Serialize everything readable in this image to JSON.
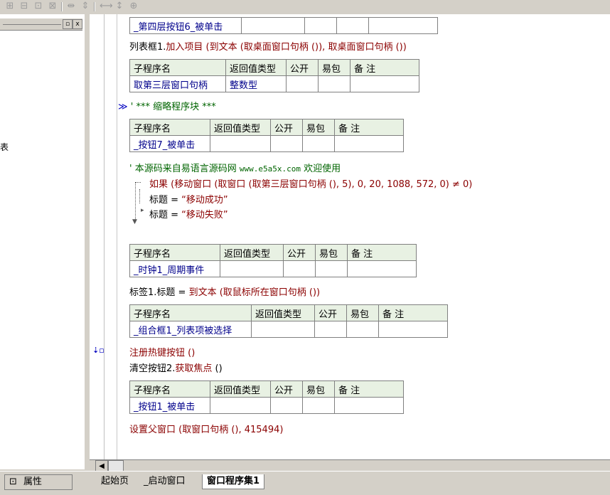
{
  "toolbar": {
    "icons": [
      "align-left-icon",
      "align-center-icon",
      "align-top-icon",
      "align-bottom-icon",
      "space-horizontal-icon",
      "space-vertical-icon",
      "same-width-icon",
      "same-height-icon",
      "same-size-icon"
    ]
  },
  "left_panel": {
    "side_text": "表",
    "btn_min": "▫",
    "btn_close": "x"
  },
  "editor": {
    "t0": {
      "row": [
        "_第四层按钮6_被单击",
        "",
        "",
        "",
        ""
      ]
    },
    "l1": {
      "a": "列表框1.",
      "b": "加入项目",
      "c": " (到文本 (取桌面窗口句柄 ()), 取桌面窗口句柄 ())"
    },
    "t1": {
      "headers": [
        "子程序名",
        "返回值类型",
        "公开",
        "易包",
        "备 注"
      ],
      "row": [
        "取第三层窗口句柄",
        "整数型",
        "",
        "",
        ""
      ]
    },
    "l2": {
      "arrow": "≫",
      "text": "' *** 缩略程序块 ***"
    },
    "t2": {
      "headers": [
        "子程序名",
        "返回值类型",
        "公开",
        "易包",
        "备 注"
      ],
      "row": [
        "_按钮7_被单击",
        "",
        "",
        "",
        ""
      ]
    },
    "l3": {
      "a": "' 本源码来自易语言源码网 ",
      "b": "www.e5a5x.com",
      "c": "  欢迎使用"
    },
    "l4": {
      "a": "如果 (移动窗口 (取窗口 (取第三层窗口句柄 (), 5), 0, 20, 1088, 572, 0) ≠ 0)"
    },
    "l5": {
      "a": "标题 = ",
      "b": "“移动成功”"
    },
    "l6": {
      "a": "标题 = ",
      "b": "“移动失败”"
    },
    "t3": {
      "headers": [
        "子程序名",
        "返回值类型",
        "公开",
        "易包",
        "备 注"
      ],
      "row": [
        "_时钟1_周期事件",
        "",
        "",
        "",
        ""
      ]
    },
    "l7": {
      "a": "标签1.标题 = ",
      "b": "到文本 (取鼠标所在窗口句柄 ())"
    },
    "t4": {
      "headers": [
        "子程序名",
        "返回值类型",
        "公开",
        "易包",
        "备 注"
      ],
      "row": [
        "_组合框1_列表项被选择",
        "",
        "",
        "",
        ""
      ]
    },
    "l8": {
      "a": "注册热键按钮 ()"
    },
    "l9": {
      "a": "清空按钮2.",
      "b": "获取焦点",
      "c": " ()"
    },
    "t5": {
      "headers": [
        "子程序名",
        "返回值类型",
        "公开",
        "易包",
        "备 注"
      ],
      "row": [
        "_按钮1_被单击",
        "",
        "",
        "",
        ""
      ]
    },
    "l10": {
      "a": "设置父窗口 (取窗口句柄 (), 415494)"
    },
    "gutter_icon": "breakpoint-icon"
  },
  "bottom": {
    "prop_label": "属性",
    "tabs": [
      "起始页",
      "_启动窗口",
      "窗口程序集1"
    ]
  }
}
